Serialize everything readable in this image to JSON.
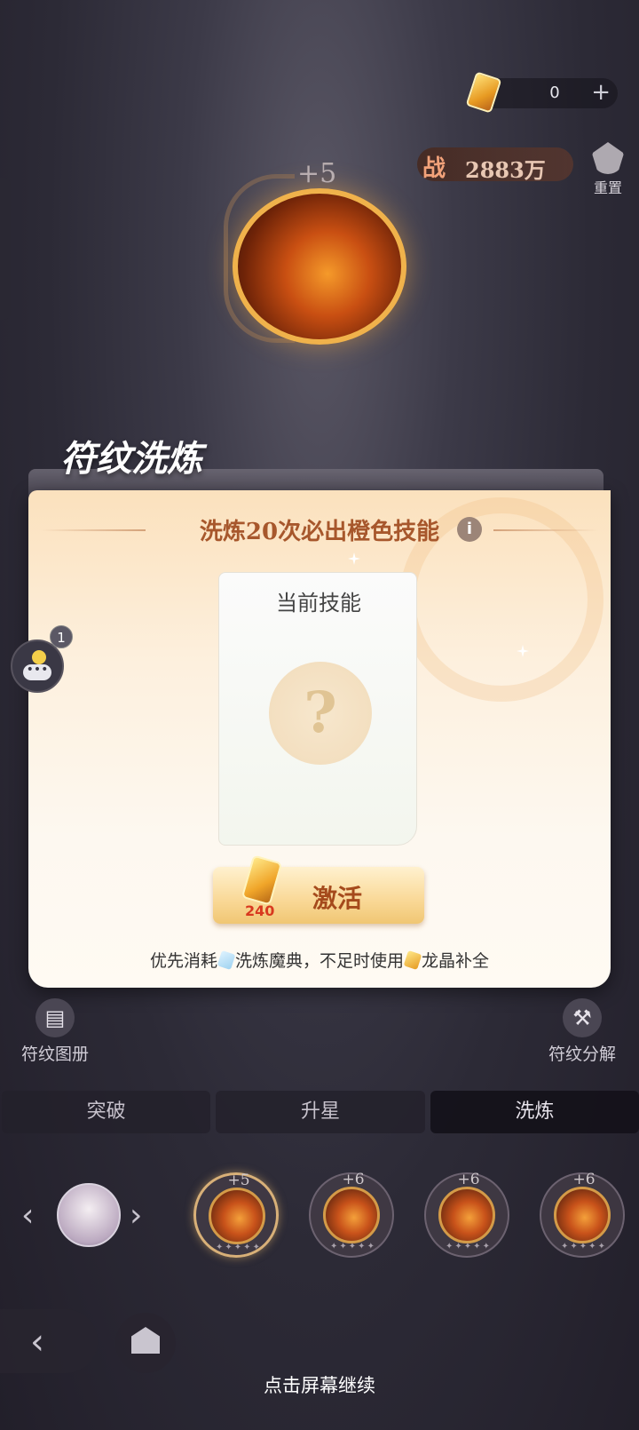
{
  "currency": {
    "value": "0",
    "plus": "+"
  },
  "power": {
    "label": "战",
    "value": "2883万"
  },
  "reset": {
    "label": "重置"
  },
  "rune": {
    "level": "+5"
  },
  "panel": {
    "title": "符纹洗炼",
    "hint": "洗炼20次必出橙色技能",
    "info": "i",
    "skill_card": {
      "title": "当前技能",
      "placeholder": "?"
    },
    "activate": {
      "label": "激活",
      "cost": "240"
    },
    "cost_note_prefix": "优先消耗",
    "cost_note_item1": "洗炼魔典，不足时使用",
    "cost_note_item2": "龙晶补全"
  },
  "chat": {
    "badge": "1",
    "dots": "•••"
  },
  "side_buttons": {
    "gallery": "符纹图册",
    "decompose": "符纹分解"
  },
  "tabs": [
    "突破",
    "升星",
    "洗炼"
  ],
  "active_tab": "洗炼",
  "rune_strip": [
    {
      "level": "+5",
      "stars": "✦✦✦✦✦"
    },
    {
      "level": "+6",
      "stars": "✦✦✦✦✦"
    },
    {
      "level": "+6",
      "stars": "✦✦✦✦✦"
    },
    {
      "level": "+6",
      "stars": "✦✦✦✦✦"
    }
  ],
  "nav": {
    "prev": "‹",
    "next": "›",
    "back": "‹"
  },
  "footer": {
    "continue": "点击屏幕继续"
  },
  "colors": {
    "accent": "#a7572c",
    "panel_bg": "#fdf0de",
    "cost_red": "#d8391f"
  }
}
